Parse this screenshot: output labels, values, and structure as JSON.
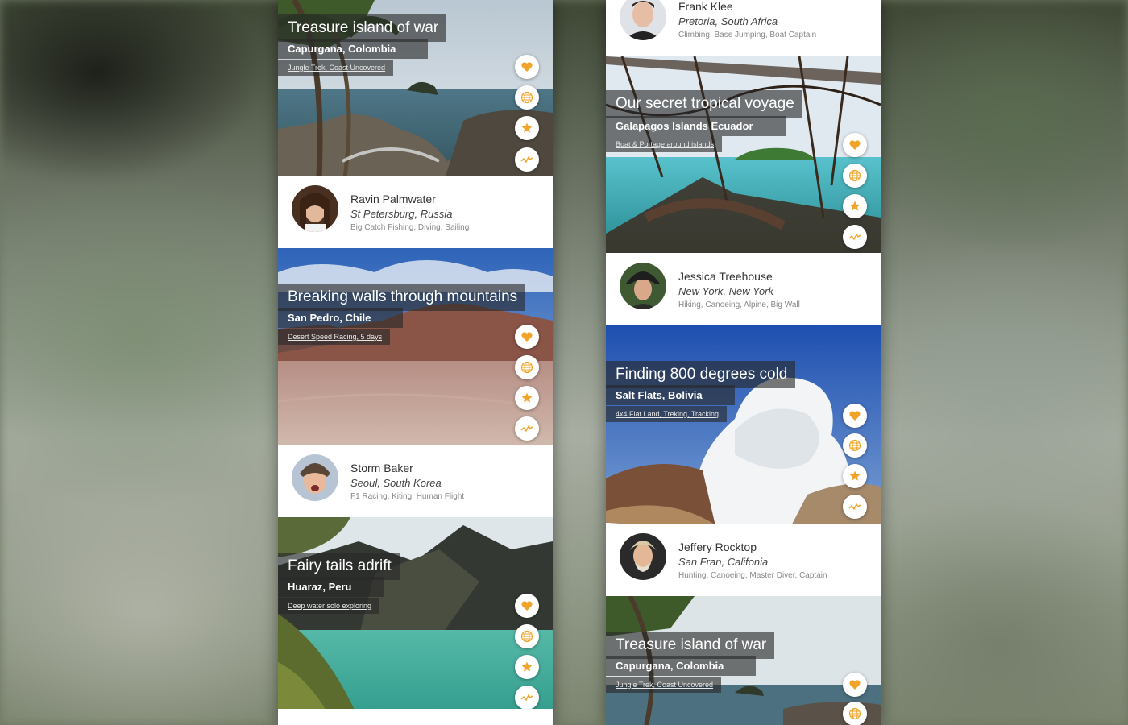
{
  "colors": {
    "accent": "#f0a52a",
    "caption_bg": "#333333"
  },
  "action_icons": [
    "heart-icon",
    "globe-icon",
    "star-icon",
    "activity-icon"
  ],
  "left": {
    "trips": [
      {
        "title": "Treasure island of war",
        "location": "Capurgana, Colombia",
        "tags": "Jungle Trek, Coast Uncovered"
      },
      {
        "title": "Breaking walls through mountains",
        "location": "San Pedro, Chile",
        "tags": "Desert Speed Racing, 5 days"
      },
      {
        "title": "Fairy tails adrift",
        "location": "Huaraz, Peru",
        "tags": "Deep water solo exploring"
      }
    ],
    "people": [
      {
        "name": "Ravin Palmwater",
        "location": "St Petersburg, Russia",
        "skills": "Big Catch Fishing, Diving, Sailing"
      },
      {
        "name": "Storm Baker",
        "location": "Seoul, South Korea",
        "skills": "F1 Racing, Kiting, Human Flight"
      }
    ]
  },
  "right": {
    "people": [
      {
        "name": "Frank Klee",
        "location": "Pretoria, South Africa",
        "skills": "Climbing, Base Jumping, Boat Captain"
      },
      {
        "name": "Jessica Treehouse",
        "location": "New York, New York",
        "skills": "Hiking, Canoeing, Alpine, Big Wall"
      },
      {
        "name": "Jeffery Rocktop",
        "location": "San Fran, Califonia",
        "skills": "Hunting, Canoeing, Master Diver, Captain"
      }
    ],
    "trips": [
      {
        "title": "Our secret tropical voyage",
        "location": "Galapagos Islands Ecuador",
        "tags": "Boat & Portage around islands"
      },
      {
        "title": "Finding 800 degrees cold",
        "location": "Salt Flats, Bolivia",
        "tags": "4x4 Flat Land, Treking, Tracking"
      },
      {
        "title": "Treasure island of war",
        "location": "Capurgana, Colombia",
        "tags": "Jungle Trek, Coast Uncovered"
      }
    ]
  }
}
